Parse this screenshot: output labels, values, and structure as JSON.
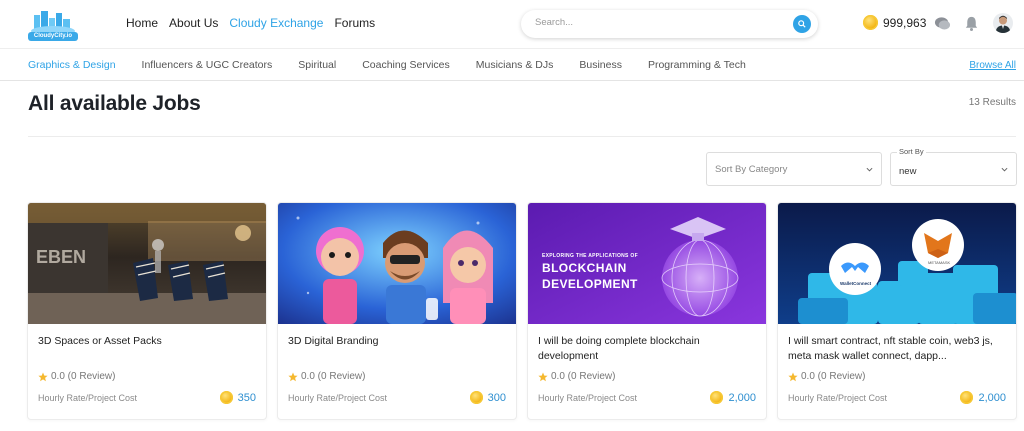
{
  "logo": {
    "text": "CloudyCity.io"
  },
  "nav": {
    "links": [
      {
        "label": "Home",
        "active": false
      },
      {
        "label": "About Us",
        "active": false
      },
      {
        "label": "Cloudy Exchange",
        "active": true
      },
      {
        "label": "Forums",
        "active": false
      }
    ]
  },
  "search": {
    "placeholder": "Search..."
  },
  "wallet": {
    "balance": "999,963"
  },
  "categories": {
    "items": [
      {
        "label": "Graphics & Design",
        "active": true
      },
      {
        "label": "Influencers & UGC Creators",
        "active": false
      },
      {
        "label": "Spiritual",
        "active": false
      },
      {
        "label": "Coaching Services",
        "active": false
      },
      {
        "label": "Musicians & DJs",
        "active": false
      },
      {
        "label": "Business",
        "active": false
      },
      {
        "label": "Programming & Tech",
        "active": false
      }
    ],
    "browse_all": "Browse All"
  },
  "page": {
    "title": "All available Jobs",
    "results": "13 Results"
  },
  "filters": {
    "category_placeholder": "Sort By Category",
    "sort_label": "Sort By",
    "sort_value": "new"
  },
  "jobs": [
    {
      "title": "3D Spaces or Asset Packs",
      "rating": "0.0 (0 Review)",
      "rate_label": "Hourly Rate/Project Cost",
      "price": "350",
      "thumb_text": ""
    },
    {
      "title": "3D Digital Branding",
      "rating": "0.0 (0 Review)",
      "rate_label": "Hourly Rate/Project Cost",
      "price": "300",
      "thumb_text": ""
    },
    {
      "title": "I will be doing complete blockchain development",
      "rating": "0.0 (0 Review)",
      "rate_label": "Hourly Rate/Project Cost",
      "price": "2,000",
      "thumb_small": "EXPLORING THE APPLICATIONS OF",
      "thumb_line1": "BLOCKCHAIN",
      "thumb_line2": "DEVELOPMENT"
    },
    {
      "title": "I will smart contract, nft stable coin, web3 js, meta mask wallet connect, dapp...",
      "rating": "0.0 (0 Review)",
      "rate_label": "Hourly Rate/Project Cost",
      "price": "2,000",
      "thumb_left": "WalletConnect",
      "thumb_right": "METAMASK"
    }
  ],
  "colors": {
    "accent": "#2fa3e6",
    "star": "#f5b82e",
    "coin": "#f3b719",
    "blockchain_bg": "#7b2ad1"
  }
}
